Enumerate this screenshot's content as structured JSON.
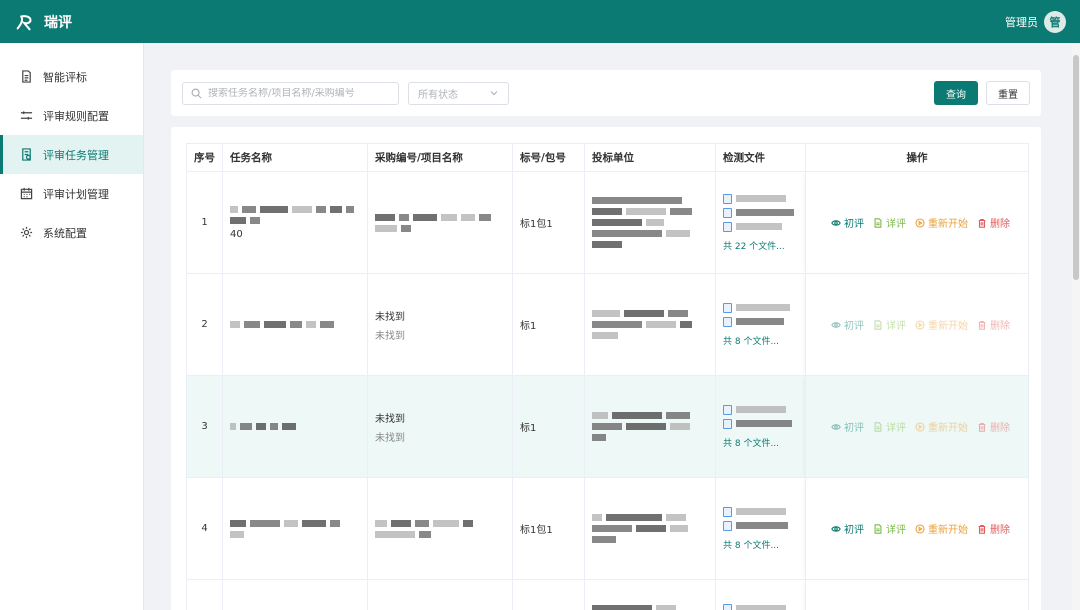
{
  "header": {
    "app_name": "瑞评",
    "user_name": "管理员",
    "avatar_text": "管"
  },
  "sidebar": {
    "items": [
      {
        "label": "智能评标",
        "icon": "document-icon",
        "active": false
      },
      {
        "label": "评审规则配置",
        "icon": "sliders-icon",
        "active": false
      },
      {
        "label": "评审任务管理",
        "icon": "task-icon",
        "active": true
      },
      {
        "label": "评审计划管理",
        "icon": "calendar-icon",
        "active": false
      },
      {
        "label": "系统配置",
        "icon": "gear-icon",
        "active": false
      }
    ]
  },
  "filters": {
    "search_placeholder": "搜索任务名称/项目名称/采购编号",
    "status_placeholder": "所有状态",
    "query_label": "查询",
    "reset_label": "重置"
  },
  "table": {
    "headers": [
      "序号",
      "任务名称",
      "采购编号/项目名称",
      "标号/包号",
      "投标单位",
      "检测文件",
      "操作"
    ],
    "rows": [
      {
        "index": "1",
        "name_suffix": "40",
        "proc_main": "",
        "proc_sub": "",
        "package": "标1包1",
        "files_more": "共 22 个文件..."
      },
      {
        "index": "2",
        "name_suffix": "",
        "proc_main": "未找到",
        "proc_sub": "未找到",
        "package": "标1",
        "files_more": "共 8 个文件..."
      },
      {
        "index": "3",
        "name_suffix": "",
        "proc_main": "未找到",
        "proc_sub": "未找到",
        "package": "标1",
        "files_more": "共 8 个文件..."
      },
      {
        "index": "4",
        "name_suffix": "",
        "proc_main": "",
        "proc_sub": "",
        "package": "标1包1",
        "files_more": "共 8 个文件..."
      }
    ],
    "actions": {
      "first": "初评",
      "detail": "详评",
      "restart": "重新开始",
      "delete": "删除"
    }
  },
  "colors": {
    "primary": "#0b7a72",
    "detail": "#7bb94a",
    "restart": "#e8a33a",
    "delete": "#e05b5b"
  }
}
